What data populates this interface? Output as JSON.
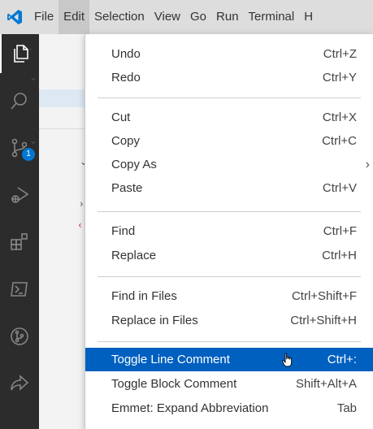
{
  "menubar": {
    "items": [
      "File",
      "Edit",
      "Selection",
      "View",
      "Go",
      "Run",
      "Terminal",
      "H"
    ],
    "active": "Edit"
  },
  "activity_bar": {
    "icons": [
      "explorer-icon",
      "search-icon",
      "source-control-icon",
      "run-debug-icon",
      "extensions-icon",
      "terminal-icon",
      "git-graph-icon",
      "remote-share-icon"
    ],
    "source_control_badge": "1"
  },
  "edit_menu": {
    "groups": [
      [
        {
          "label": "Undo",
          "shortcut": "Ctrl+Z"
        },
        {
          "label": "Redo",
          "shortcut": "Ctrl+Y"
        }
      ],
      [
        {
          "label": "Cut",
          "shortcut": "Ctrl+X"
        },
        {
          "label": "Copy",
          "shortcut": "Ctrl+C"
        },
        {
          "label": "Copy As",
          "shortcut": ""
        },
        {
          "label": "Paste",
          "shortcut": "Ctrl+V"
        }
      ],
      [
        {
          "label": "Find",
          "shortcut": "Ctrl+F"
        },
        {
          "label": "Replace",
          "shortcut": "Ctrl+H"
        }
      ],
      [
        {
          "label": "Find in Files",
          "shortcut": "Ctrl+Shift+F"
        },
        {
          "label": "Replace in Files",
          "shortcut": "Ctrl+Shift+H"
        }
      ],
      [
        {
          "label": "Toggle Line Comment",
          "shortcut": "Ctrl+:"
        },
        {
          "label": "Toggle Block Comment",
          "shortcut": "Shift+Alt+A"
        },
        {
          "label": "Emmet: Expand Abbreviation",
          "shortcut": "Tab"
        }
      ]
    ],
    "highlighted": "Toggle Line Comment"
  },
  "colors": {
    "menubar_bg": "#dddddd",
    "activity_bg": "#2c2c2c",
    "highlight": "#0060c0",
    "badge": "#0078d4",
    "logo": "#0078d4"
  }
}
